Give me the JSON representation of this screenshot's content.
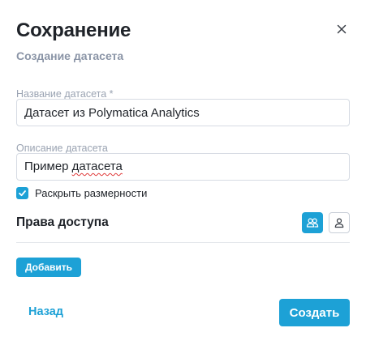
{
  "dialog": {
    "title": "Сохранение",
    "subtitle": "Создание датасета",
    "close_icon": "close-icon"
  },
  "form": {
    "name_label": "Название датасета *",
    "name_value": "Датасет из Polymatica Analytics",
    "description_label": "Описание датасета",
    "description_value_word1": "Пример ",
    "description_value_word2": "датасета",
    "expand_dimensions_label": "Раскрыть размерности",
    "expand_dimensions_checked": true
  },
  "permissions": {
    "title": "Права доступа",
    "group_icon": "users-group-icon",
    "user_icon": "user-icon",
    "add_label": "Добавить"
  },
  "footer": {
    "back_label": "Назад",
    "create_label": "Создать"
  },
  "colors": {
    "accent": "#1da1d6",
    "text": "#1f2329",
    "muted": "#9aa3b2",
    "border": "#d6dbe3"
  }
}
